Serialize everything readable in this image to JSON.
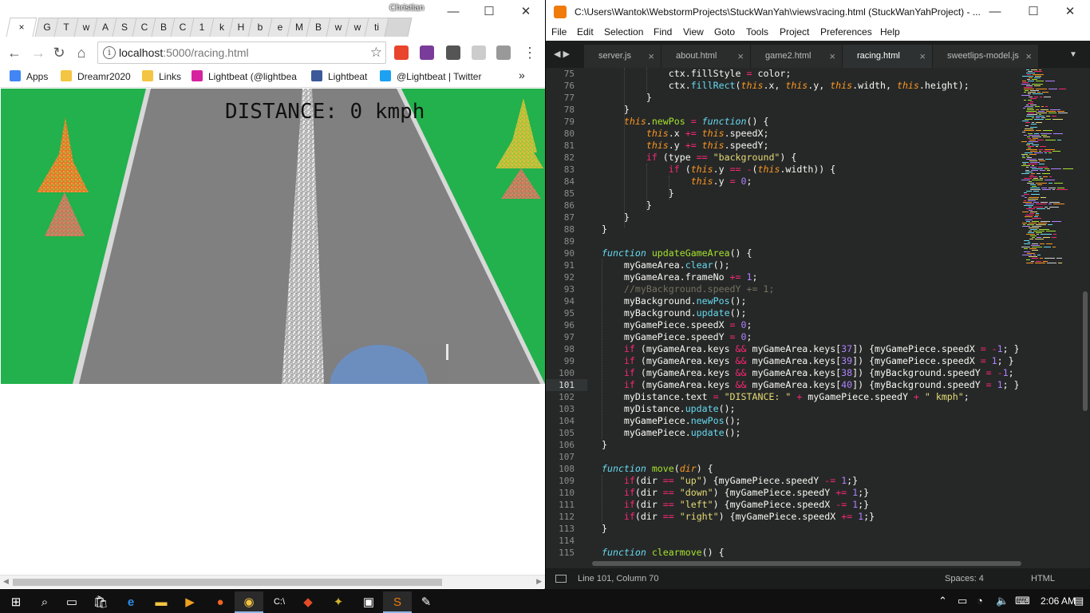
{
  "chrome": {
    "user_name": "Christian",
    "tabs": [
      "G",
      "T",
      "w",
      "A",
      "S",
      "C",
      "B",
      "C",
      "1",
      "k",
      "H",
      "b",
      "e",
      "M",
      "B",
      "w",
      "w",
      "ti"
    ],
    "active_tab_close": "×",
    "url_host": "localhost",
    "url_path": ":5000/racing.html",
    "bookmarks": [
      {
        "label": "Apps",
        "color": "#4285f4"
      },
      {
        "label": "Dreamr2020",
        "color": "#f4c542"
      },
      {
        "label": "Links",
        "color": "#f4c542"
      },
      {
        "label": "Lightbeat (@lightbea",
        "color": "#d6249f"
      },
      {
        "label": "Lightbeat",
        "color": "#3b5998"
      },
      {
        "label": "@Lightbeat | Twitter",
        "color": "#1da1f2"
      }
    ],
    "bookmarks_overflow": "»"
  },
  "game": {
    "distance_text": "DISTANCE: 0 kmph",
    "colors": {
      "grass": "#22b14c",
      "road": "#808080",
      "player": "#6c8ebf"
    }
  },
  "sublime": {
    "title": "C:\\Users\\Wantok\\WebstormProjects\\StuckWanYah\\views\\racing.html (StuckWanYahProject) - ...",
    "menu": [
      "File",
      "Edit",
      "Selection",
      "Find",
      "View",
      "Goto",
      "Tools",
      "Project",
      "Preferences",
      "Help"
    ],
    "tabs": [
      "server.js",
      "about.html",
      "game2.html",
      "racing.html",
      "sweetlips-model.js"
    ],
    "active_tab": "racing.html",
    "line_numbers": [
      "75",
      "76",
      "77",
      "78",
      "79",
      "80",
      "81",
      "82",
      "83",
      "84",
      "85",
      "86",
      "87",
      "88",
      "89",
      "90",
      "91",
      "92",
      "93",
      "94",
      "95",
      "96",
      "97",
      "98",
      "99",
      "100",
      "101",
      "102",
      "103",
      "104",
      "105",
      "106",
      "107",
      "108",
      "109",
      "110",
      "111",
      "112",
      "113",
      "114",
      "115"
    ],
    "status_position": "Line 101, Column 70",
    "status_spaces": "Spaces: 4",
    "status_syntax": "HTML"
  },
  "taskbar": {
    "clock": "2:06 AM"
  }
}
